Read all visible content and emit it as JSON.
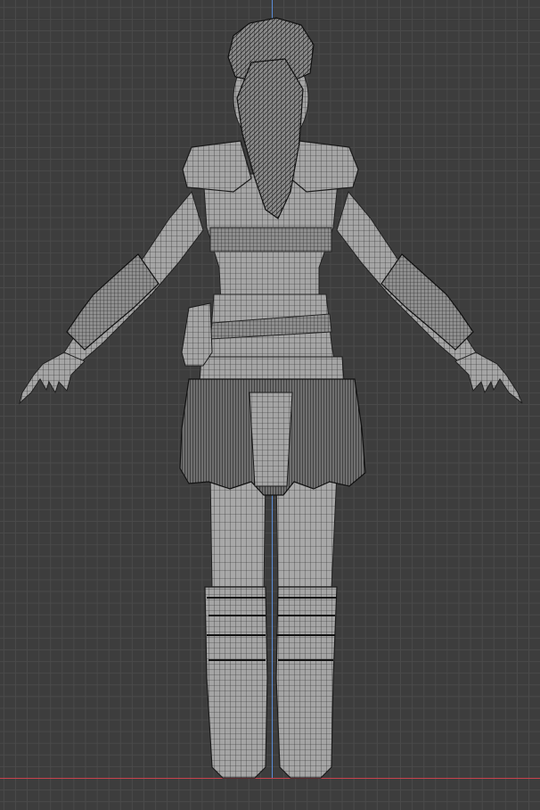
{
  "viewport": {
    "view": "back-orthographic",
    "colors": {
      "background": "#3d3d3d",
      "grid_minor": "#4a4a4a",
      "grid_major": "#2f2f2f",
      "axis_z": "#5b8cd6",
      "axis_x": "#c8424d",
      "mesh_fill": "#9c9c9c",
      "mesh_wire": "#1e1e1e"
    }
  },
  "model": {
    "mode": "wireframe-overlay",
    "parts": [
      "hair-bun",
      "ponytail",
      "head",
      "shoulder-pads",
      "torso",
      "belt-sash",
      "pouch",
      "skirt",
      "legs",
      "left-boot",
      "right-boot",
      "left-arm-wraps",
      "right-arm-wraps",
      "hands"
    ]
  }
}
